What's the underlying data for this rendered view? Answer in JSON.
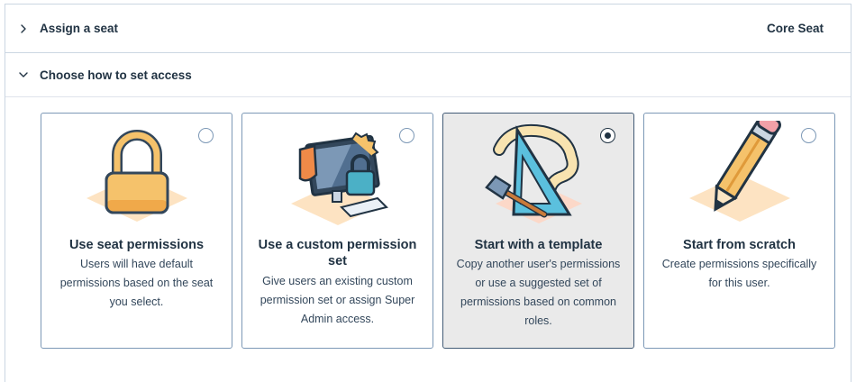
{
  "seat_section": {
    "title": "Assign a seat",
    "value": "Core Seat",
    "icon": "chevron-right-icon"
  },
  "access_section": {
    "title": "Choose how to set access",
    "icon": "chevron-down-icon"
  },
  "options": [
    {
      "title": "Use seat permissions",
      "description": "Users will have default permissions based on the seat you select.",
      "icon": "padlock-icon",
      "selected": false
    },
    {
      "title": "Use a custom permission set",
      "description": "Give users an existing custom permission set or assign Super Admin access.",
      "icon": "computer-lock-shield-icon",
      "selected": false
    },
    {
      "title": "Start with a template",
      "description": "Copy another user's permissions or use a suggested set of permissions based on common roles.",
      "icon": "ruler-hammer-tape-icon",
      "selected": true
    },
    {
      "title": "Start from scratch",
      "description": "Create permissions specifically for this user.",
      "icon": "pencil-icon",
      "selected": false
    }
  ],
  "colors": {
    "border": "#cbd6e2",
    "card_border": "#7c98b6",
    "selected_bg": "#eaeaea",
    "text_dark": "#213343"
  }
}
